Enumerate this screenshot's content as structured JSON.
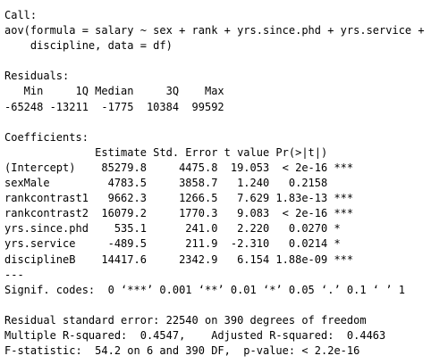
{
  "console": {
    "lines": [
      "Call:",
      "aov(formula = salary ~ sex + rank + yrs.since.phd + yrs.service +",
      "    discipline, data = df)",
      "",
      "Residuals:",
      "   Min     1Q Median     3Q    Max",
      "-65248 -13211  -1775  10384  99592",
      "",
      "Coefficients:",
      "              Estimate Std. Error t value Pr(>|t|)    ",
      "(Intercept)    85279.8     4475.8  19.053  < 2e-16 ***",
      "sexMale         4783.5     3858.7   1.240   0.2158    ",
      "rankcontrast1   9662.3     1266.5   7.629 1.83e-13 ***",
      "rankcontrast2  16079.2     1770.3   9.083  < 2e-16 ***",
      "yrs.since.phd    535.1      241.0   2.220   0.0270 *  ",
      "yrs.service     -489.5      211.9  -2.310   0.0214 *  ",
      "disciplineB    14417.6     2342.9   6.154 1.88e-09 ***",
      "---",
      "Signif. codes:  0 ‘***’ 0.001 ‘**’ 0.01 ‘*’ 0.05 ‘.’ 0.1 ‘ ’ 1",
      "",
      "Residual standard error: 22540 on 390 degrees of freedom",
      "Multiple R-squared:  0.4547,    Adjusted R-squared:  0.4463 ",
      "F-statistic:  54.2 on 6 and 390 DF,  p-value: < 2.2e-16"
    ]
  }
}
